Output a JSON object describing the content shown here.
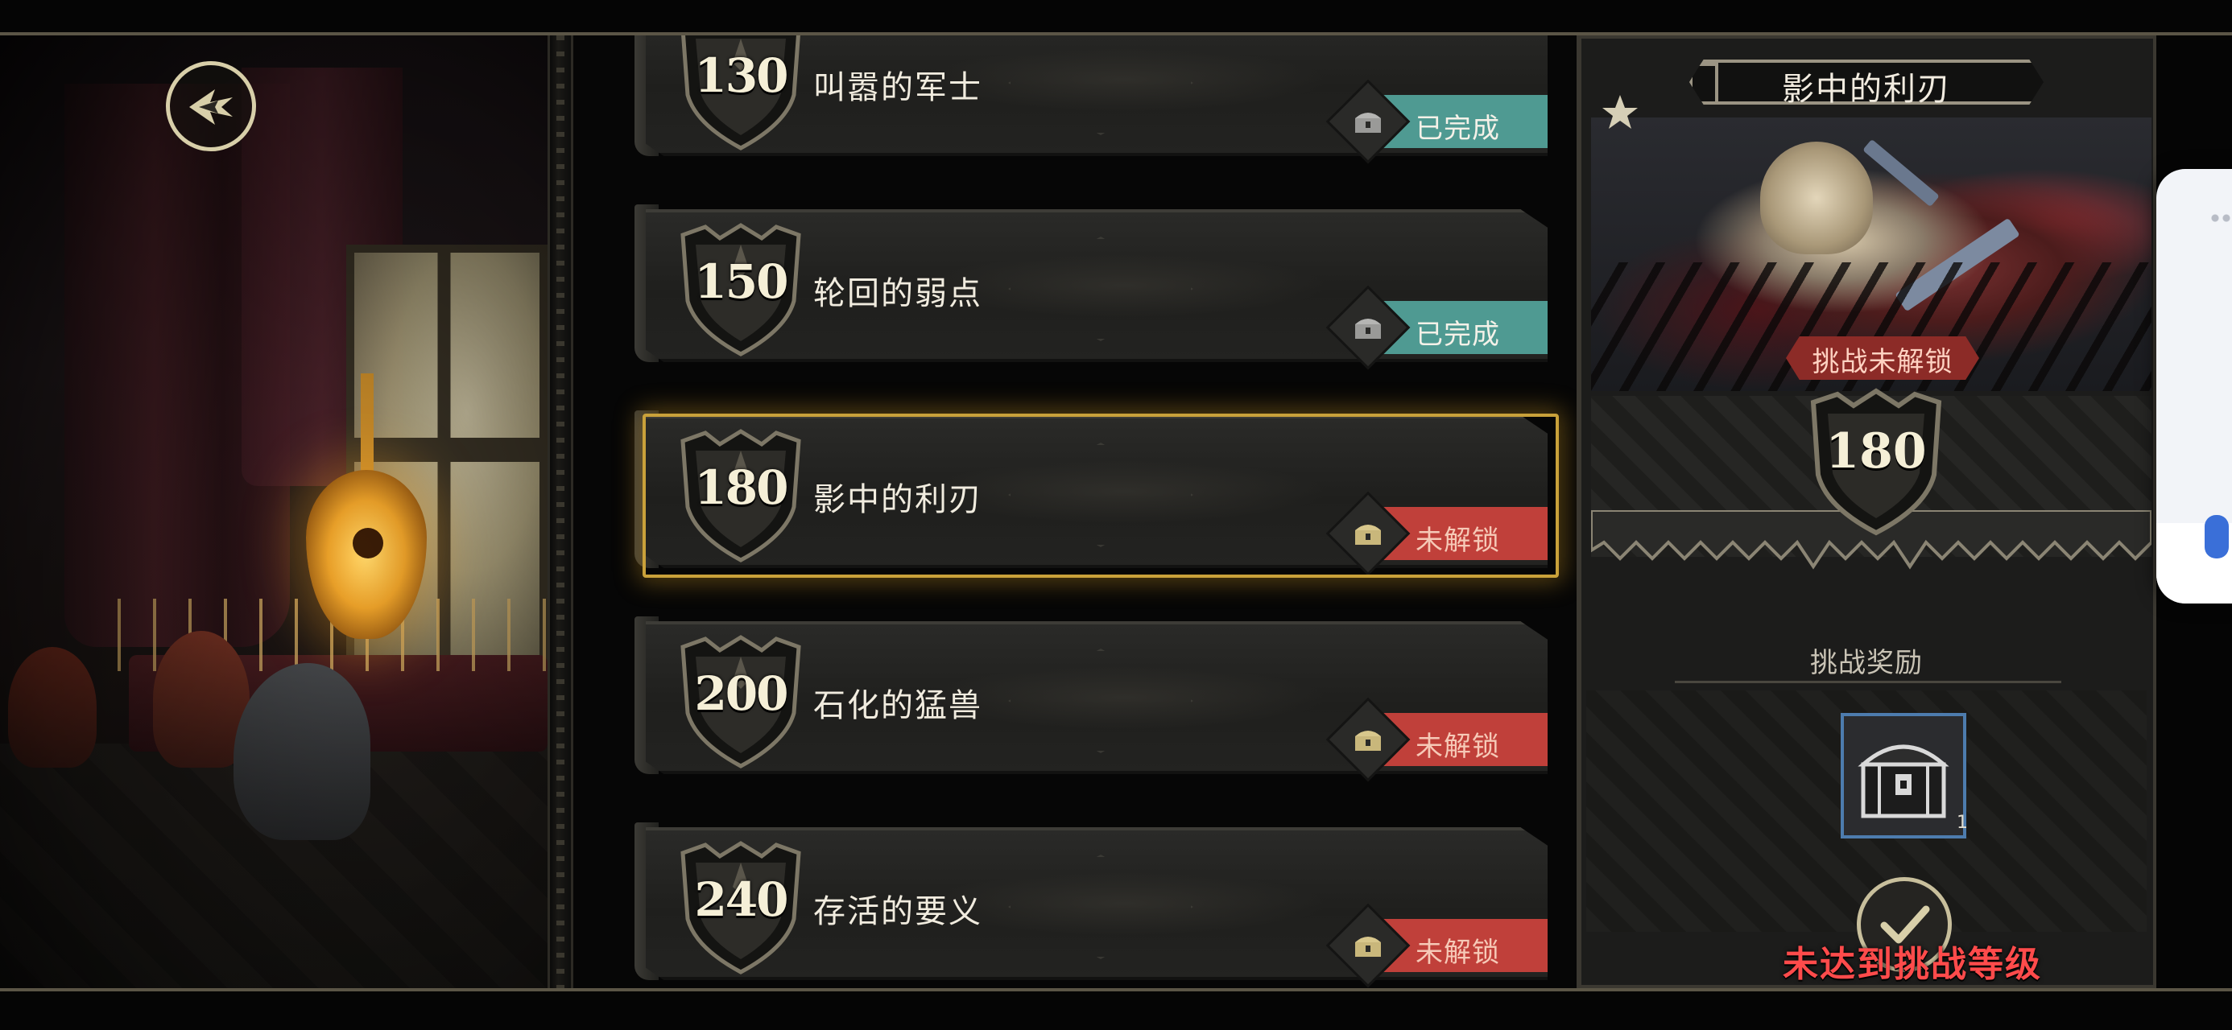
{
  "back_button": {
    "icon": "back-arrow-icon"
  },
  "challenges": [
    {
      "level": "130",
      "name": "叫嚣的军士",
      "status": "已完成",
      "state": "done"
    },
    {
      "level": "150",
      "name": "轮回的弱点",
      "status": "已完成",
      "state": "done"
    },
    {
      "level": "180",
      "name": "影中的利刃",
      "status": "未解锁",
      "state": "locked",
      "selected": true
    },
    {
      "level": "200",
      "name": "石化的猛兽",
      "status": "未解锁",
      "state": "locked"
    },
    {
      "level": "240",
      "name": "存活的要义",
      "status": "未解锁",
      "state": "locked"
    }
  ],
  "detail": {
    "title": "影中的利刃",
    "lock_banner": "挑战未解锁",
    "level": "180",
    "reward_label": "挑战奖励",
    "reward_item": {
      "icon": "treasure-chest-icon",
      "count": "1"
    },
    "confirm_icon": "checkmark-icon",
    "warning": "未达到挑战等级"
  },
  "colors": {
    "done_bar": "#4f9a92",
    "locked_bar": "#c0403a",
    "selected_border": "#c9a13a",
    "warning_text": "#ff4b4b",
    "reward_border": "#4d7cae"
  }
}
